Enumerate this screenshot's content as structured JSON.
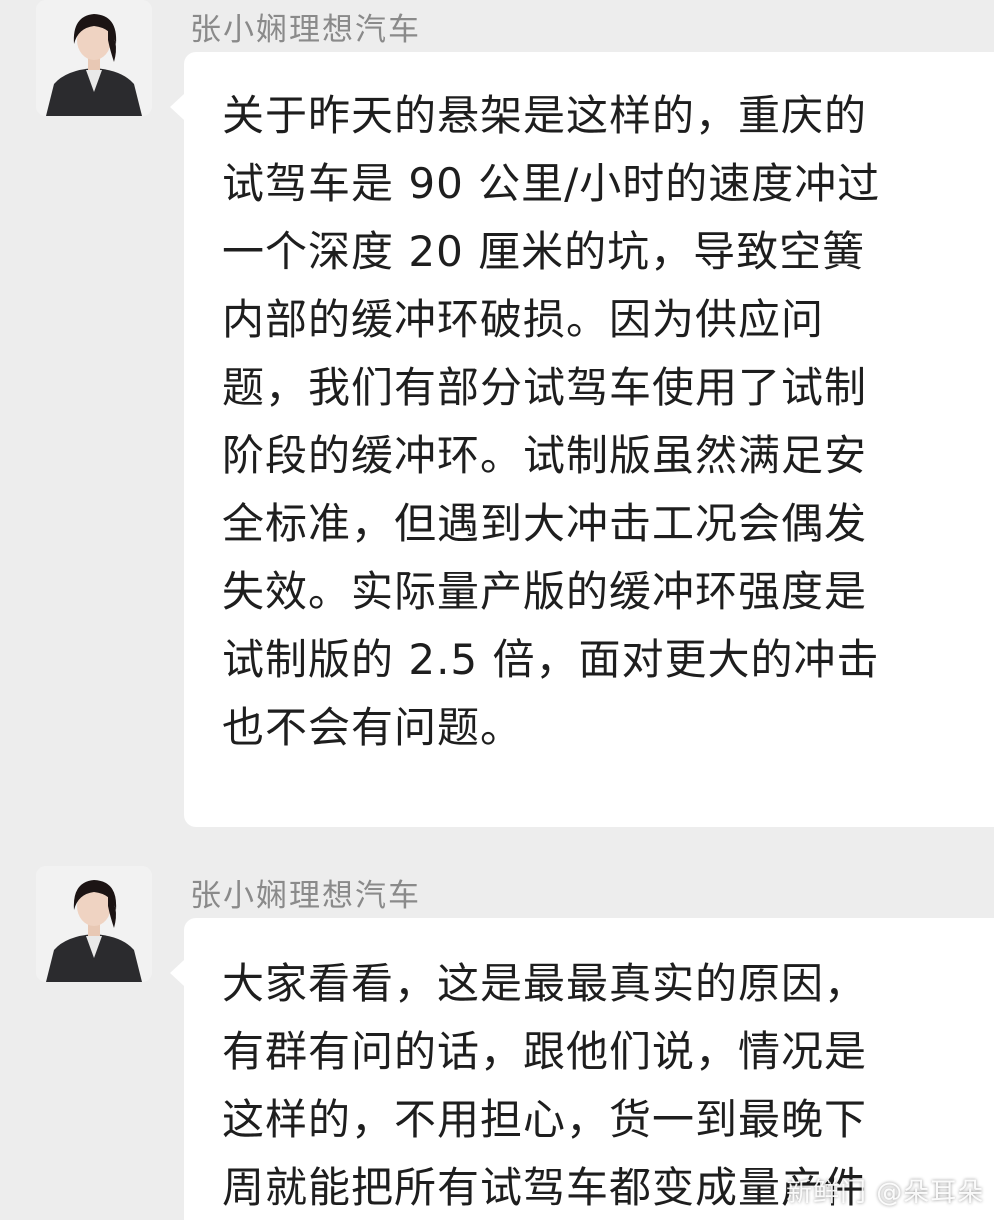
{
  "messages": [
    {
      "sender": "张小娴理想汽车",
      "lines": [
        "关于昨天的悬架是这样的，重庆的",
        "试驾车是 90 公里/小时的速度冲过",
        "一个深度 20 厘米的坑，导致空簧",
        "内部的缓冲环破损。因为供应问",
        "题，我们有部分试驾车使用了试制",
        "阶段的缓冲环。试制版虽然满足安",
        "全标准，但遇到大冲击工况会偶发",
        "失效。实际量产版的缓冲环强度是",
        "试制版的 2.5 倍，面对更大的冲击",
        "也不会有问题。"
      ]
    },
    {
      "sender": "张小娴理想汽车",
      "lines": [
        "大家看看，这是最最真实的原因，",
        "有群有问的话，跟他们说，情况是",
        "这样的，不用担心，货一到最晚下",
        "周就能把所有试驾车都变成量产件"
      ]
    }
  ],
  "watermark": "新鲜门 @朵耳朵",
  "colors": {
    "background": "#ededed",
    "bubble": "#ffffff",
    "sender_text": "#8a8a8a",
    "message_text": "#1e1e1e"
  },
  "icons": {
    "avatar": "profile-photo"
  }
}
